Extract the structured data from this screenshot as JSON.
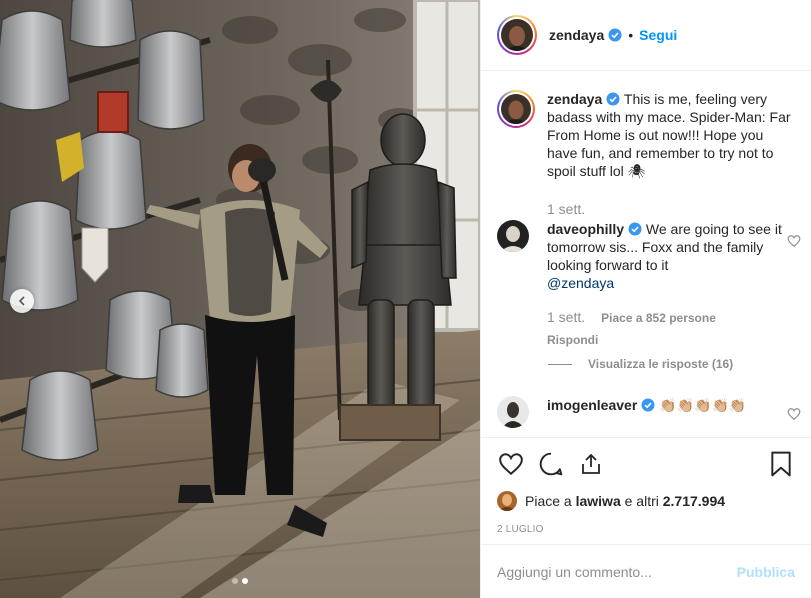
{
  "post": {
    "author": "zendaya",
    "verified": true,
    "separator": "•",
    "follow_label": "Segui",
    "caption_author": "zendaya",
    "caption_text": "This is me, feeling very badass with my mace. Spider-Man: Far From Home is out now!!! Hope you have fun, and remember to try not to spoil stuff lol 🕷",
    "caption_time": "1 sett.",
    "carousel": {
      "slide_count": 2,
      "active_slide": 2
    }
  },
  "comments": [
    {
      "user": "daveophilly",
      "verified": true,
      "text": "We are going to see it tomorrow sis... Foxx and the family looking forward to it",
      "mention": "@zendaya",
      "time": "1 sett.",
      "likes": "Piace a 852 persone",
      "reply_label": "Rispondi",
      "view_replies": "Visualizza le risposte (16)"
    },
    {
      "user": "imogenleaver",
      "verified": true,
      "text": "👏🏼👏🏼👏🏼👏🏼👏🏼"
    }
  ],
  "engagement": {
    "likes_prefix": "Piace a",
    "liked_by": "lawiwa",
    "likes_and": "e altri",
    "likes_count": "2.717.994",
    "date": "2 LUGLIO"
  },
  "composer": {
    "placeholder": "Aggiungi un commento...",
    "publish_label": "Pubblica"
  },
  "icons": {
    "verified": "verified-badge-icon",
    "like": "heart-icon",
    "comment": "comment-icon",
    "share": "share-icon",
    "save": "bookmark-icon",
    "prev": "chevron-left-icon"
  },
  "colors": {
    "accent": "#0095f6",
    "publish_disabled": "#b2dffc",
    "muted": "#8e8e8e",
    "text": "#262626",
    "border": "#efefef"
  }
}
